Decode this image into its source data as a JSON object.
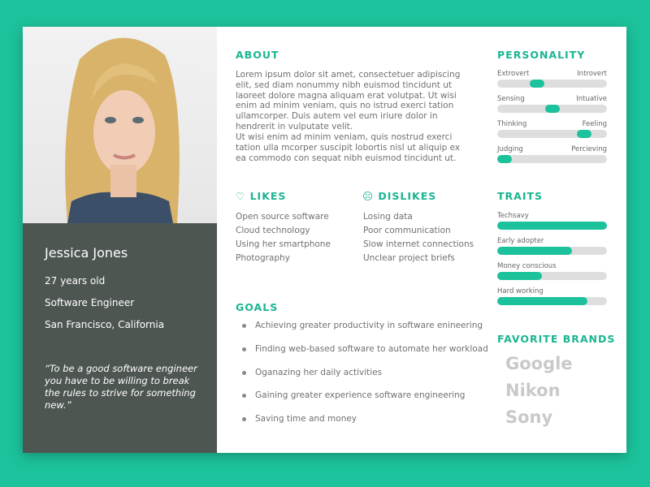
{
  "profile": {
    "name": "Jessica Jones",
    "age": "27 years old",
    "job": "Software Engineer",
    "location": "San Francisco, California",
    "quote": "“To be a good software engineer you have to be willing to break the rules to strive for something new.”"
  },
  "about": {
    "title": "ABOUT",
    "p1": "Lorem ipsum dolor sit amet, consectetuer adipiscing elit, sed diam nonummy nibh euismod tincidunt ut laoreet dolore magna aliquam erat volutpat. Ut wisi enim ad minim veniam, quis no istrud exerci tation ullamcorper. Duis autem vel eum iriure dolor in hendrerit in vulputate velit.",
    "p2": "Ut wisi enim ad minim veniam, quis nostrud exerci tation ulla mcorper suscipit lobortis nisl ut aliquip ex ea commodo con sequat nibh euismod tincidunt ut."
  },
  "likes": {
    "title": "LIKES",
    "icon": "heart-icon",
    "items": [
      "Open source software",
      "Cloud technology",
      "Using her smartphone",
      "Photography"
    ]
  },
  "dislikes": {
    "title": "DISLIKES",
    "icon": "sad-face-icon",
    "items": [
      "Losing data",
      "Poor communication",
      "Slow internet connections",
      "Unclear project briefs"
    ]
  },
  "goals": {
    "title": "GOALS",
    "items": [
      "Achieving greater productivity in software enineering",
      "Finding web-based software to automate her workload",
      "Oganazing her daily activities",
      "Gaining greater experience software engineering",
      "Saving time and money"
    ]
  },
  "personality": {
    "title": "PERSONALITY",
    "items": [
      {
        "left": "Extrovert",
        "right": "Introvert",
        "value": 0.36
      },
      {
        "left": "Sensing",
        "right": "Intuative",
        "value": 0.5
      },
      {
        "left": "Thinking",
        "right": "Feeling",
        "value": 0.79
      },
      {
        "left": "Judging",
        "right": "Percieving",
        "value": 0.07
      }
    ]
  },
  "traits": {
    "title": "TRAITS",
    "items": [
      {
        "label": "Techsavy",
        "value": 1.0
      },
      {
        "label": "Early adopter",
        "value": 0.68
      },
      {
        "label": "Money conscious",
        "value": 0.41
      },
      {
        "label": "Hard working",
        "value": 0.82
      }
    ]
  },
  "brands": {
    "title": "FAVORITE BRANDS",
    "items": [
      "Google",
      "Nikon",
      "Sony"
    ]
  },
  "colors": {
    "accent": "#1cc29b",
    "panel": "#4e5652",
    "background": "#1cc29b"
  }
}
